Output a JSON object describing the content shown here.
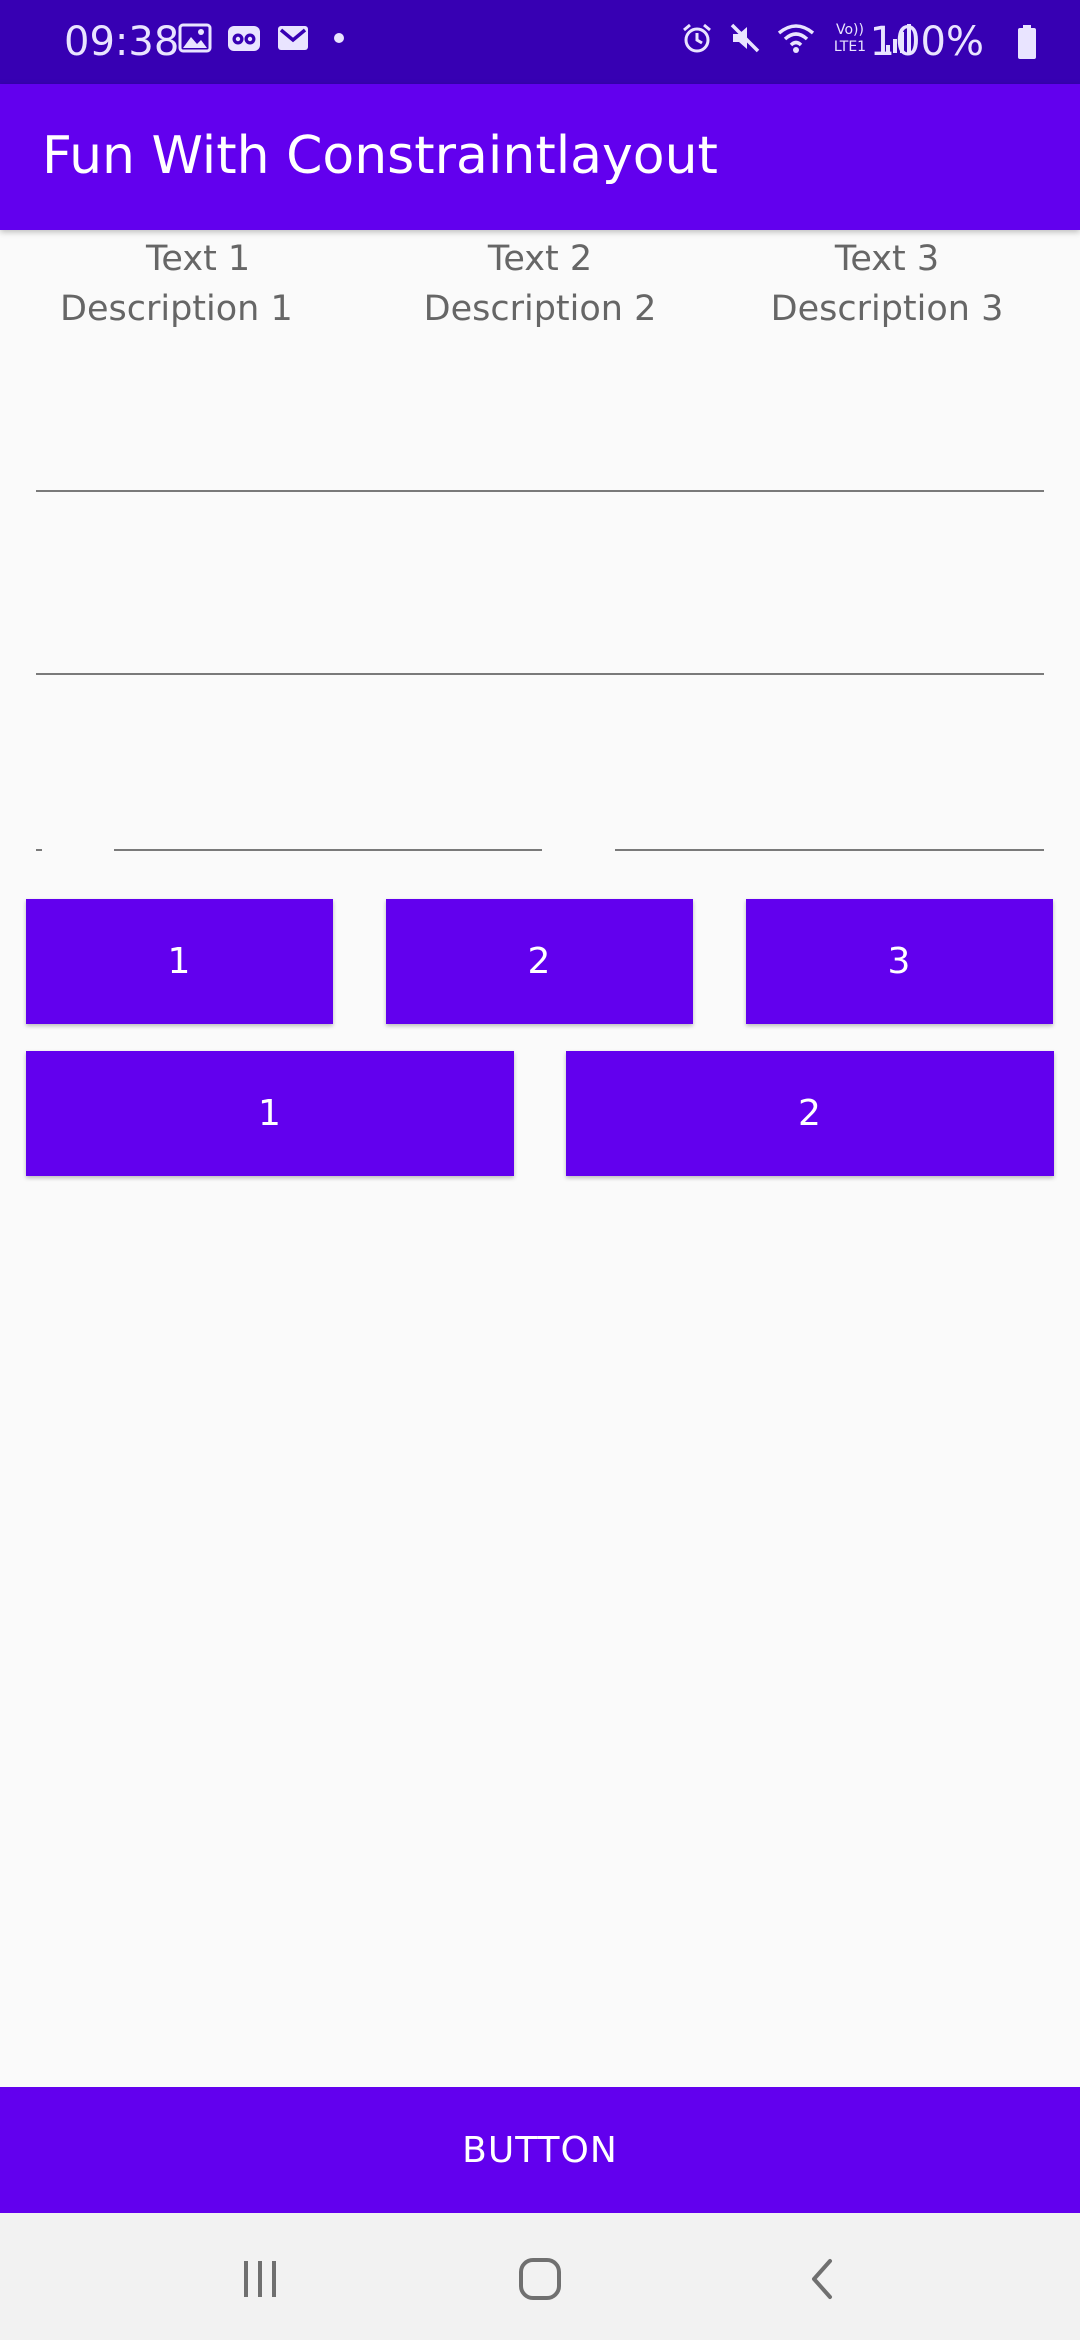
{
  "status_bar": {
    "time": "09:38",
    "battery_percent": "100%",
    "left_icons": [
      "gallery-icon",
      "tripadvisor-icon",
      "gmail-icon",
      "notification-dot-icon"
    ],
    "right_icons": [
      "alarm-icon",
      "mute-icon",
      "wifi-icon",
      "volte-icon",
      "signal-icon"
    ],
    "volte_label": "Vo))\nLTE1",
    "battery_level": 1.0
  },
  "app_bar": {
    "title": "Fun With Constraintlayout"
  },
  "text_columns": [
    {
      "title": "Text 1",
      "description": "Description 1"
    },
    {
      "title": "Text 2",
      "description": "Description 2"
    },
    {
      "title": "Text 3",
      "description": "Description 3"
    }
  ],
  "button_row_1": [
    "1",
    "2",
    "3"
  ],
  "button_row_2": [
    "1",
    "2"
  ],
  "bottom_button": {
    "label": "BUTTON"
  },
  "nav_bar": {
    "items": [
      "recents-icon",
      "home-icon",
      "back-icon"
    ]
  },
  "colors": {
    "status_bar": "#3700b3",
    "primary": "#6200ee",
    "background": "#fafafa",
    "text_secondary": "#666666"
  }
}
